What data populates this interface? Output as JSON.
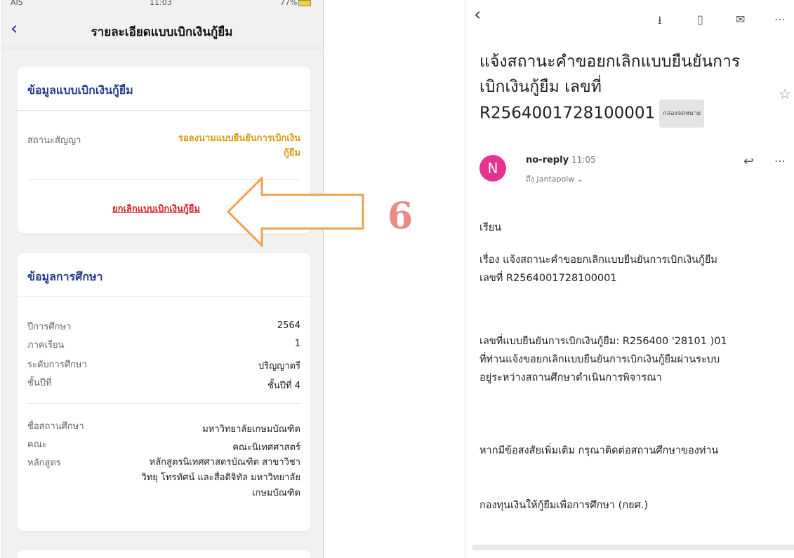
{
  "left": {
    "status_bar": {
      "carrier": "AIS",
      "time": "11:03",
      "battery": "77%"
    },
    "title": "รายละเอียดแบบเบิกเงินกู้ยืม",
    "card1": {
      "title": "ข้อมูลแบบเบิกเงินกู้ยืม",
      "status_label": "สถานะสัญญา",
      "status_value_1": "รอลงนามแบบยืนยันการเบิกเงิน",
      "status_value_2": "กู้ยืม",
      "cancel_link": "ยกเลิกแบบเบิกเงินกู้ยืม"
    },
    "card2": {
      "title": "ข้อมูลการศึกษา",
      "rows1": [
        {
          "label": "ปีการศึกษา",
          "value": "2564"
        },
        {
          "label": "ภาคเรียน",
          "value": "1"
        },
        {
          "label": "ระดับการศึกษา",
          "value": "ปริญญาตรี"
        },
        {
          "label": "ชั้นปีที่",
          "value": "ชั้นปีที่ 4"
        }
      ],
      "school_label": "ชื่อสถานศึกษา",
      "school_value": "มหาวิทยาลัยเกษมบัณฑิต",
      "faculty_label": "คณะ",
      "faculty_value": "คณะนิเทศศาสตร์",
      "program_label": "หลักสูตร",
      "program_value_1": "หลักสูตรนิเทศศาสตรบัณฑิต สาขาวิชา",
      "program_value_2": "วิทยุ โทรทัศน์ และสื่อดิจิทัล มหาวิทยาลัย",
      "program_value_3": "เกษมบัณฑิต"
    }
  },
  "annotation": {
    "step": "6",
    "arrow_color": "#f0a04b"
  },
  "right": {
    "subject_1": "แจ้งสถานะคำขอยกเลิกแบบยืนยันการ",
    "subject_2": "เบิกเงินกู้ยืม เลขที่",
    "subject_3": "R2564001728100001",
    "inbox_chip": "กล่องจดหมาย",
    "avatar_letter": "N",
    "sender": "no-reply",
    "sender_time": "11:05",
    "recipient": "ถึง Jantapolw ⌄",
    "greeting": "เรียน",
    "topic_1": "เรื่อง แจ้งสถานะคำขอยกเลิกแบบยืนยันการเบิกเงินกู้ยืม",
    "topic_2": "เลขที่ R2564001728100001",
    "para_1": "เลขที่แบบยืนยันการเบิกเงินกู้ยืม: R256400 '28101 )01",
    "para_2": "ที่ท่านแจ้งขอยกเลิกแบบยืนยันการเบิกเงินกู้ยืมผ่านระบบ",
    "para_3": "อยู่ระหว่างสถานศึกษาดำเนินการพิจารณา",
    "contact": "หากมีข้อสงสัยเพิ่มเติม กรุณาติดต่อสถานศึกษาของท่าน",
    "signature": "กองทุนเงินให้กู้ยืมเพื่อการศึกษา (กยศ.)"
  },
  "colors": {
    "nav_blue": "#233a8a",
    "status_orange": "#d99a12",
    "link_red": "#d8202a",
    "avatar_pink": "#e6348e"
  },
  "icons": [
    "back-chevron-icon",
    "archive-icon",
    "trash-icon",
    "mail-icon",
    "more-icon",
    "star-icon",
    "reply-icon"
  ]
}
